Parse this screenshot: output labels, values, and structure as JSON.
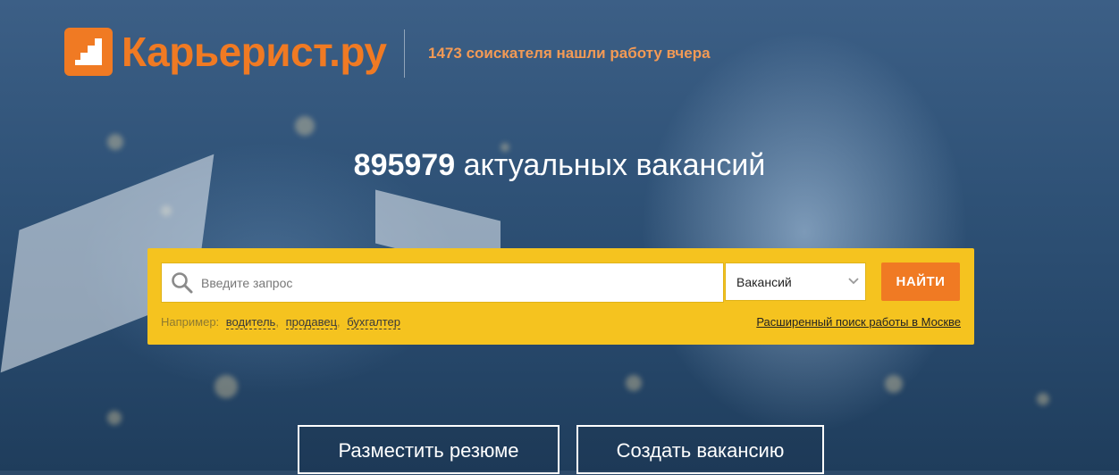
{
  "header": {
    "logo_text": "Карьерист.ру",
    "tagline_count": "1473",
    "tagline_text": "соискателя нашли работу вчера",
    "brand_color": "#f07a23"
  },
  "hero": {
    "vacancies_count": "895979",
    "vacancies_label": "актуальных вакансий"
  },
  "search": {
    "placeholder": "Введите запрос",
    "type_selected": "Вакансий",
    "find_label": "НАЙТИ",
    "examples_label": "Например:",
    "examples": [
      "водитель",
      "продавец",
      "бухгалтер"
    ],
    "advanced_link": "Расширенный поиск работы в Москве",
    "panel_color": "#f5c31f"
  },
  "actions": {
    "post_resume": "Разместить резюме",
    "create_vacancy": "Создать вакансию"
  },
  "icons": {
    "logo": "stairs-icon",
    "search": "search-icon",
    "select": "chevron-down-icon"
  }
}
